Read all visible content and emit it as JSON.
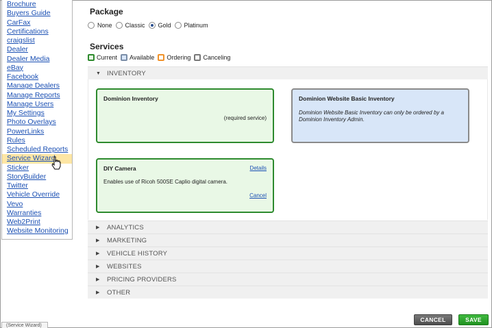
{
  "sidebar": {
    "items": [
      {
        "label": "Brochure"
      },
      {
        "label": "Buyers Guide"
      },
      {
        "label": "CarFax"
      },
      {
        "label": "Certifications"
      },
      {
        "label": "craigslist"
      },
      {
        "label": "Dealer"
      },
      {
        "label": "Dealer Media"
      },
      {
        "label": "eBay"
      },
      {
        "label": "Facebook"
      },
      {
        "label": "Manage Dealers"
      },
      {
        "label": "Manage Reports"
      },
      {
        "label": "Manage Users"
      },
      {
        "label": "My Settings"
      },
      {
        "label": "Photo Overlays"
      },
      {
        "label": "PowerLinks"
      },
      {
        "label": "Rules"
      },
      {
        "label": "Scheduled Reports"
      },
      {
        "label": "Service Wizard"
      },
      {
        "label": "Sticker"
      },
      {
        "label": "StoryBuilder"
      },
      {
        "label": "Twitter"
      },
      {
        "label": "Vehicle Override"
      },
      {
        "label": "Vevo"
      },
      {
        "label": "Warranties"
      },
      {
        "label": "Web2Print"
      },
      {
        "label": "Website Monitoring"
      }
    ],
    "active_item": "Service Wizard"
  },
  "bottom_tab": {
    "label": "(Service Wizard)"
  },
  "package": {
    "title": "Package",
    "options": [
      {
        "label": "None",
        "checked": false
      },
      {
        "label": "Classic",
        "checked": false
      },
      {
        "label": "Gold",
        "checked": true
      },
      {
        "label": "Platinum",
        "checked": false
      }
    ]
  },
  "services": {
    "title": "Services",
    "legend": [
      {
        "label": "Current",
        "color": "#2d8a2d",
        "fill": "#e9f8e6"
      },
      {
        "label": "Available",
        "color": "#7a8da8",
        "fill": "#d8e6f8"
      },
      {
        "label": "Ordering",
        "color": "#f0922a",
        "fill": "#fff"
      },
      {
        "label": "Canceling",
        "color": "#777777",
        "fill": "#fff"
      }
    ]
  },
  "accordion": {
    "expanded": {
      "label": "INVENTORY",
      "icon": "triangle-down-icon"
    },
    "cards": [
      {
        "title": "Dominion Inventory",
        "note": "(required service)",
        "status": "current"
      },
      {
        "title": "Dominion Website Basic Inventory",
        "description": "Dominion Website Basic Inventory can only be ordered by a Dominion Inventory Admin.",
        "status": "available"
      },
      {
        "title": "DIY Camera",
        "details_link": "Details",
        "description": "Enables use of Ricoh 500SE Caplio digital camera.",
        "cancel_link": "Cancel",
        "status": "current"
      }
    ],
    "collapsed": [
      {
        "label": "ANALYTICS"
      },
      {
        "label": "MARKETING"
      },
      {
        "label": "VEHICLE HISTORY"
      },
      {
        "label": "WEBSITES"
      },
      {
        "label": "PRICING PROVIDERS"
      },
      {
        "label": "OTHER"
      }
    ]
  },
  "actions": {
    "cancel_label": "CANCEL",
    "save_label": "SAVE"
  }
}
